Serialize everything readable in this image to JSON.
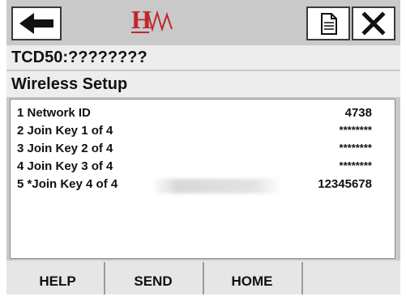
{
  "header": {
    "back_icon": "left-arrow-icon",
    "logo_text": "H",
    "doc_icon": "document-icon",
    "close_icon": "close-x-icon",
    "logo_color": "#c0272d"
  },
  "device_label": "TCD50:????????",
  "screen_title": "Wireless Setup",
  "settings": [
    {
      "label": "1 Network ID",
      "value": "4738"
    },
    {
      "label": "2 Join Key 1 of 4",
      "value": "********"
    },
    {
      "label": "3 Join Key 2 of 4",
      "value": "********"
    },
    {
      "label": "4 Join Key 3 of 4",
      "value": "********"
    },
    {
      "label": "5 *Join Key 4 of 4",
      "value": "12345678"
    }
  ],
  "softkeys": {
    "help": "HELP",
    "send": "SEND",
    "home": "HOME"
  }
}
